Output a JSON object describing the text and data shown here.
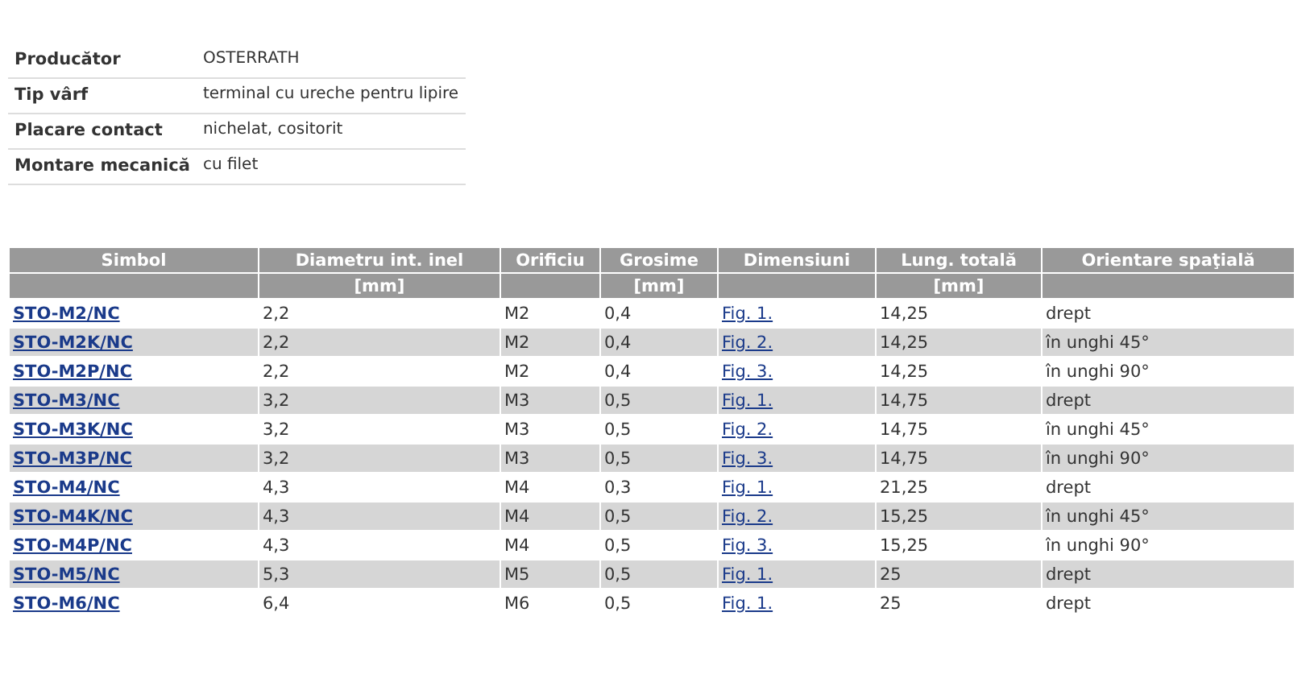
{
  "properties": [
    {
      "label": "Producător",
      "value": "OSTERRATH"
    },
    {
      "label": "Tip vârf",
      "value": "terminal cu ureche pentru lipire"
    },
    {
      "label": "Placare contact",
      "value": "nichelat,\ncositorit"
    },
    {
      "label": "Montare mecanică",
      "value": "cu filet"
    }
  ],
  "table": {
    "columns": [
      {
        "label": "Simbol"
      },
      {
        "label": "Diametru int. inel",
        "unit": "[mm]"
      },
      {
        "label": "Orificiu"
      },
      {
        "label": "Grosime",
        "unit": "[mm]"
      },
      {
        "label": "Dimensiuni"
      },
      {
        "label": "Lung. totală",
        "unit": "[mm]"
      },
      {
        "label": "Orientare spaţială"
      }
    ],
    "rows": [
      [
        "STO-M2/NC",
        "2,2",
        "M2",
        "0,4",
        "Fig. 1.",
        "14,25",
        "drept"
      ],
      [
        "STO-M2K/NC",
        "2,2",
        "M2",
        "0,4",
        "Fig. 2.",
        "14,25",
        "în unghi 45°"
      ],
      [
        "STO-M2P/NC",
        "2,2",
        "M2",
        "0,4",
        "Fig. 3.",
        "14,25",
        "în unghi 90°"
      ],
      [
        "STO-M3/NC",
        "3,2",
        "M3",
        "0,5",
        "Fig. 1.",
        "14,75",
        "drept"
      ],
      [
        "STO-M3K/NC",
        "3,2",
        "M3",
        "0,5",
        "Fig. 2.",
        "14,75",
        "în unghi 45°"
      ],
      [
        "STO-M3P/NC",
        "3,2",
        "M3",
        "0,5",
        "Fig. 3.",
        "14,75",
        "în unghi 90°"
      ],
      [
        "STO-M4/NC",
        "4,3",
        "M4",
        "0,3",
        "Fig. 1.",
        "21,25",
        "drept"
      ],
      [
        "STO-M4K/NC",
        "4,3",
        "M4",
        "0,5",
        "Fig. 2.",
        "15,25",
        "în unghi 45°"
      ],
      [
        "STO-M4P/NC",
        "4,3",
        "M4",
        "0,5",
        "Fig. 3.",
        "15,25",
        "în unghi 90°"
      ],
      [
        "STO-M5/NC",
        "5,3",
        "M5",
        "0,5",
        "Fig. 1.",
        "25",
        "drept"
      ],
      [
        "STO-M6/NC",
        "6,4",
        "M6",
        "0,5",
        "Fig. 1.",
        "25",
        "drept"
      ]
    ]
  }
}
